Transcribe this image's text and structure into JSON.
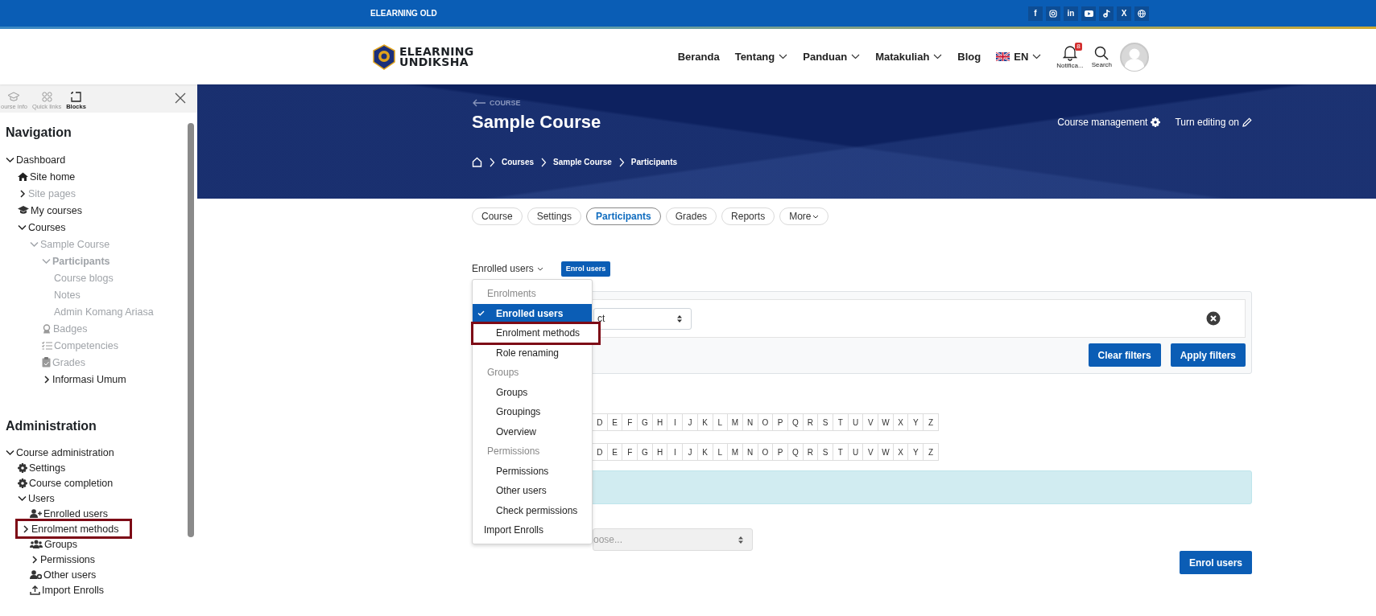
{
  "topbar": {
    "title": "ELEARNING OLD",
    "socials": [
      {
        "kind": "text",
        "glyph": "f"
      },
      {
        "kind": "camera"
      },
      {
        "kind": "text",
        "glyph": "in"
      },
      {
        "kind": "play"
      },
      {
        "kind": "note"
      },
      {
        "kind": "text",
        "glyph": "X"
      },
      {
        "kind": "globe"
      }
    ]
  },
  "header": {
    "logo": [
      "ELEARNING",
      "UNDIKSHA"
    ],
    "nav": [
      {
        "label": "Beranda",
        "kind": "link"
      },
      {
        "label": "Tentang",
        "kind": "menu"
      },
      {
        "label": "Panduan",
        "kind": "menu"
      },
      {
        "label": "Matakuliah",
        "kind": "menu"
      },
      {
        "label": "Blog",
        "kind": "link"
      },
      {
        "label": "EN",
        "kind": "lang"
      }
    ],
    "notifications": {
      "label": "Notifica...",
      "count": "8"
    },
    "search": {
      "label": "Search"
    }
  },
  "drawer": {
    "tabs": [
      {
        "label": "ourse info",
        "kind": "cap",
        "selected": false
      },
      {
        "label": "Quick links",
        "kind": "grid",
        "selected": false
      },
      {
        "label": "Blocks",
        "kind": "blocks",
        "selected": true
      }
    ],
    "sections": [
      {
        "title": "Navigation",
        "items": [
          {
            "label": "Dashboard",
            "kind": "open",
            "dimmed": false,
            "current": false,
            "highlighted": false,
            "children": [
              {
                "label": "Site home",
                "kind": "home",
                "dimmed": false,
                "current": false,
                "highlighted": false
              },
              {
                "label": "Site pages",
                "kind": "closed",
                "dimmed": true,
                "current": false,
                "highlighted": false
              },
              {
                "label": "My courses",
                "kind": "cap",
                "dimmed": false,
                "current": false,
                "highlighted": false
              },
              {
                "label": "Courses",
                "kind": "open",
                "dimmed": false,
                "current": false,
                "highlighted": false,
                "children": [
                  {
                    "label": "Sample Course",
                    "kind": "open",
                    "dimmed": true,
                    "current": false,
                    "highlighted": false,
                    "children": [
                      {
                        "label": "Participants",
                        "kind": "open",
                        "dimmed": true,
                        "current": true,
                        "highlighted": false,
                        "children": [
                          {
                            "label": "Course blogs",
                            "dimmed": true,
                            "current": false,
                            "highlighted": false
                          },
                          {
                            "label": "Notes",
                            "dimmed": true,
                            "current": false,
                            "highlighted": false
                          },
                          {
                            "label": "Admin Komang Ariasa",
                            "dimmed": true,
                            "current": false,
                            "highlighted": false
                          }
                        ]
                      },
                      {
                        "label": "Badges",
                        "kind": "badge",
                        "dimmed": true,
                        "current": false,
                        "highlighted": false
                      },
                      {
                        "label": "Competencies",
                        "kind": "list",
                        "dimmed": true,
                        "current": false,
                        "highlighted": false
                      },
                      {
                        "label": "Grades",
                        "kind": "clipboard",
                        "dimmed": true,
                        "current": false,
                        "highlighted": false
                      },
                      {
                        "label": "Informasi Umum",
                        "kind": "closed",
                        "dimmed": false,
                        "current": false,
                        "highlighted": false
                      }
                    ]
                  }
                ]
              }
            ]
          }
        ]
      },
      {
        "title": "Administration",
        "items": [
          {
            "label": "Course administration",
            "kind": "open",
            "dimmed": false,
            "current": false,
            "highlighted": false,
            "children": [
              {
                "label": "Settings",
                "kind": "gear",
                "dimmed": false,
                "current": false,
                "highlighted": false
              },
              {
                "label": "Course completion",
                "kind": "gear",
                "dimmed": false,
                "current": false,
                "highlighted": false
              },
              {
                "label": "Users",
                "kind": "open",
                "dimmed": false,
                "current": false,
                "highlighted": false,
                "children": [
                  {
                    "label": "Enrolled users",
                    "kind": "useradd",
                    "dimmed": false,
                    "current": false,
                    "highlighted": false
                  },
                  {
                    "label": "Enrolment methods",
                    "kind": "closed",
                    "dimmed": false,
                    "current": false,
                    "highlighted": true
                  },
                  {
                    "label": "Groups",
                    "kind": "users",
                    "dimmed": false,
                    "current": false,
                    "highlighted": false
                  },
                  {
                    "label": "Permissions",
                    "kind": "closed",
                    "dimmed": false,
                    "current": false,
                    "highlighted": false
                  },
                  {
                    "label": "Other users",
                    "kind": "usergear",
                    "dimmed": false,
                    "current": false,
                    "highlighted": false
                  },
                  {
                    "label": "Import Enrolls",
                    "kind": "upload",
                    "dimmed": false,
                    "current": false,
                    "highlighted": false
                  }
                ]
              }
            ]
          }
        ]
      }
    ]
  },
  "banner": {
    "back": "COURSE",
    "title": "Sample Course",
    "actions": [
      {
        "label": "Course management",
        "kind": "gear"
      },
      {
        "label": "Turn editing on",
        "kind": "pencil"
      }
    ],
    "breadcrumbs": [
      "Courses",
      "Sample Course",
      "Participants"
    ]
  },
  "tabs": [
    {
      "label": "Course",
      "selected": false,
      "dropdown": false
    },
    {
      "label": "Settings",
      "selected": false,
      "dropdown": false
    },
    {
      "label": "Participants",
      "selected": true,
      "dropdown": false
    },
    {
      "label": "Grades",
      "selected": false,
      "dropdown": false
    },
    {
      "label": "Reports",
      "selected": false,
      "dropdown": false
    },
    {
      "label": "More",
      "selected": false,
      "dropdown": true
    }
  ],
  "enrol_menu": {
    "trigger": "Enrolled users",
    "button": "Enrol users",
    "items": [
      {
        "kind": "header",
        "label": "Enrolments"
      },
      {
        "kind": "item",
        "label": "Enrolled users",
        "selected": true,
        "highlighted": false
      },
      {
        "kind": "item",
        "label": "Enrolment methods",
        "selected": false,
        "highlighted": true
      },
      {
        "kind": "item",
        "label": "Role renaming",
        "selected": false,
        "highlighted": false
      },
      {
        "kind": "header",
        "label": "Groups"
      },
      {
        "kind": "item",
        "label": "Groups",
        "selected": false,
        "highlighted": false
      },
      {
        "kind": "item",
        "label": "Groupings",
        "selected": false,
        "highlighted": false
      },
      {
        "kind": "item",
        "label": "Overview",
        "selected": false,
        "highlighted": false
      },
      {
        "kind": "header",
        "label": "Permissions"
      },
      {
        "kind": "item",
        "label": "Permissions",
        "selected": false,
        "highlighted": false
      },
      {
        "kind": "item",
        "label": "Other users",
        "selected": false,
        "highlighted": false
      },
      {
        "kind": "item",
        "label": "Check permissions",
        "selected": false,
        "highlighted": false
      },
      {
        "kind": "link",
        "label": "Import Enrolls",
        "selected": false,
        "highlighted": false
      }
    ]
  },
  "filter": {
    "select_value": "ct",
    "buttons": [
      "Clear filters",
      "Apply filters"
    ]
  },
  "initial_bars": [
    [
      "D",
      "E",
      "F",
      "G",
      "H",
      "I",
      "J",
      "K",
      "L",
      "M",
      "N",
      "O",
      "P",
      "Q",
      "R",
      "S",
      "T",
      "U",
      "V",
      "W",
      "X",
      "Y",
      "Z"
    ],
    [
      "D",
      "E",
      "F",
      "G",
      "H",
      "I",
      "J",
      "K",
      "L",
      "M",
      "N",
      "O",
      "P",
      "Q",
      "R",
      "S",
      "T",
      "U",
      "V",
      "W",
      "X",
      "Y",
      "Z"
    ]
  ],
  "enrol_select": {
    "placeholder": "oose..."
  },
  "enrol_button": "Enrol users"
}
